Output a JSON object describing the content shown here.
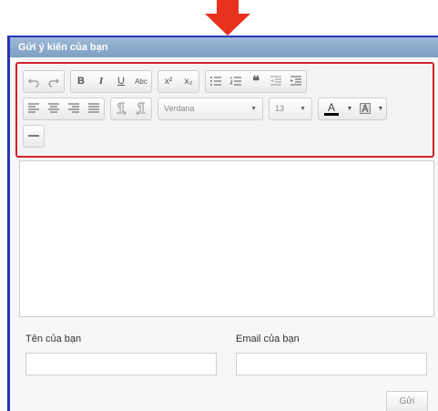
{
  "panel": {
    "title": "Gửi ý kiến của bạn"
  },
  "toolbar": {
    "bold": "B",
    "italic": "I",
    "underline": "U",
    "strike": "Abc",
    "superscript": "x²",
    "subscript": "x₂",
    "quote": "❝",
    "font": "Verdana",
    "font_size": "13",
    "text_color": "A"
  },
  "form": {
    "name_label": "Tên của bạn",
    "email_label": "Email của bạn",
    "submit": "Gửi"
  },
  "colors": {
    "header": "#8fabcb",
    "highlight_border": "#d5202a",
    "arrow": "#e8321e",
    "panel_border": "#2536b8"
  }
}
